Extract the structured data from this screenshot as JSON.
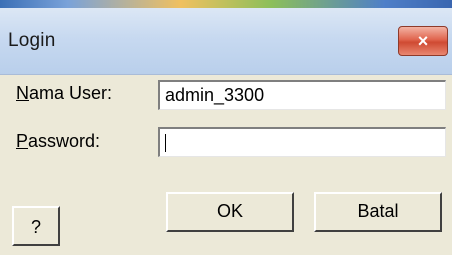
{
  "window": {
    "title": "Login",
    "close_label": "×"
  },
  "form": {
    "user_label_accel": "N",
    "user_label_rest": "ama User:",
    "user_value": "admin_3300",
    "password_label_accel": "P",
    "password_label_rest": "assword:",
    "password_value": ""
  },
  "buttons": {
    "ok_label": "OK",
    "cancel_label": "Batal",
    "help_label": "?"
  }
}
